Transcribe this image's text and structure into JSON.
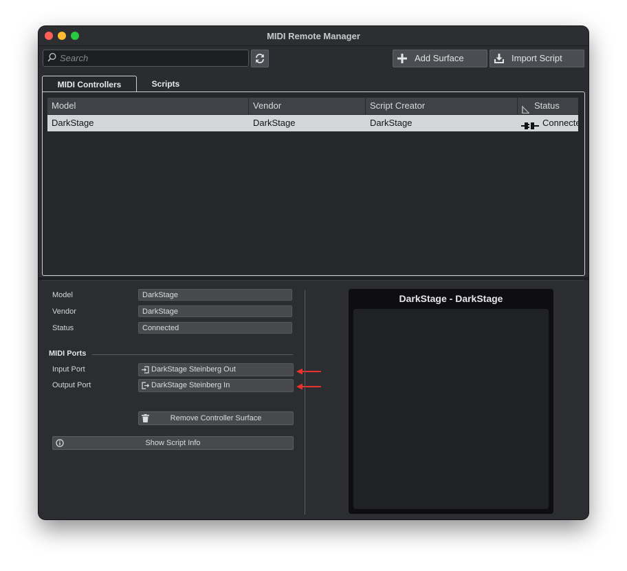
{
  "window": {
    "title": "MIDI Remote Manager"
  },
  "colors": {
    "arrow_red": "#e8322d",
    "row_selected": "#d4d5d7"
  },
  "icons": {
    "search": "search-icon",
    "refresh": "refresh-icon",
    "add": "plus-icon",
    "import": "import-icon",
    "sort": "sort-icon",
    "status": "plug-connected-icon",
    "input_port": "port-in-icon",
    "output_port": "port-out-icon",
    "trash": "trash-icon",
    "info": "info-icon"
  },
  "toolbar": {
    "search_placeholder": "Search",
    "add_surface": "Add Surface",
    "import_script": "Import Script"
  },
  "tabs": [
    {
      "label": "MIDI Controllers",
      "active": true
    },
    {
      "label": "Scripts",
      "active": false
    }
  ],
  "table": {
    "columns": [
      "Model",
      "Vendor",
      "Script Creator",
      "Status"
    ],
    "rows": [
      {
        "model": "DarkStage",
        "vendor": "DarkStage",
        "creator": "DarkStage",
        "status": "Connected"
      }
    ]
  },
  "details": {
    "model_label": "Model",
    "model_value": "DarkStage",
    "vendor_label": "Vendor",
    "vendor_value": "DarkStage",
    "status_label": "Status",
    "status_value": "Connected",
    "midi_ports_heading": "MIDI Ports",
    "input_port_label": "Input Port",
    "input_port_value": "DarkStage Steinberg Out",
    "output_port_label": "Output Port",
    "output_port_value": "DarkStage Steinberg In",
    "remove_button": "Remove Controller Surface",
    "info_button": "Show Script Info"
  },
  "preview": {
    "title": "DarkStage - DarkStage"
  }
}
